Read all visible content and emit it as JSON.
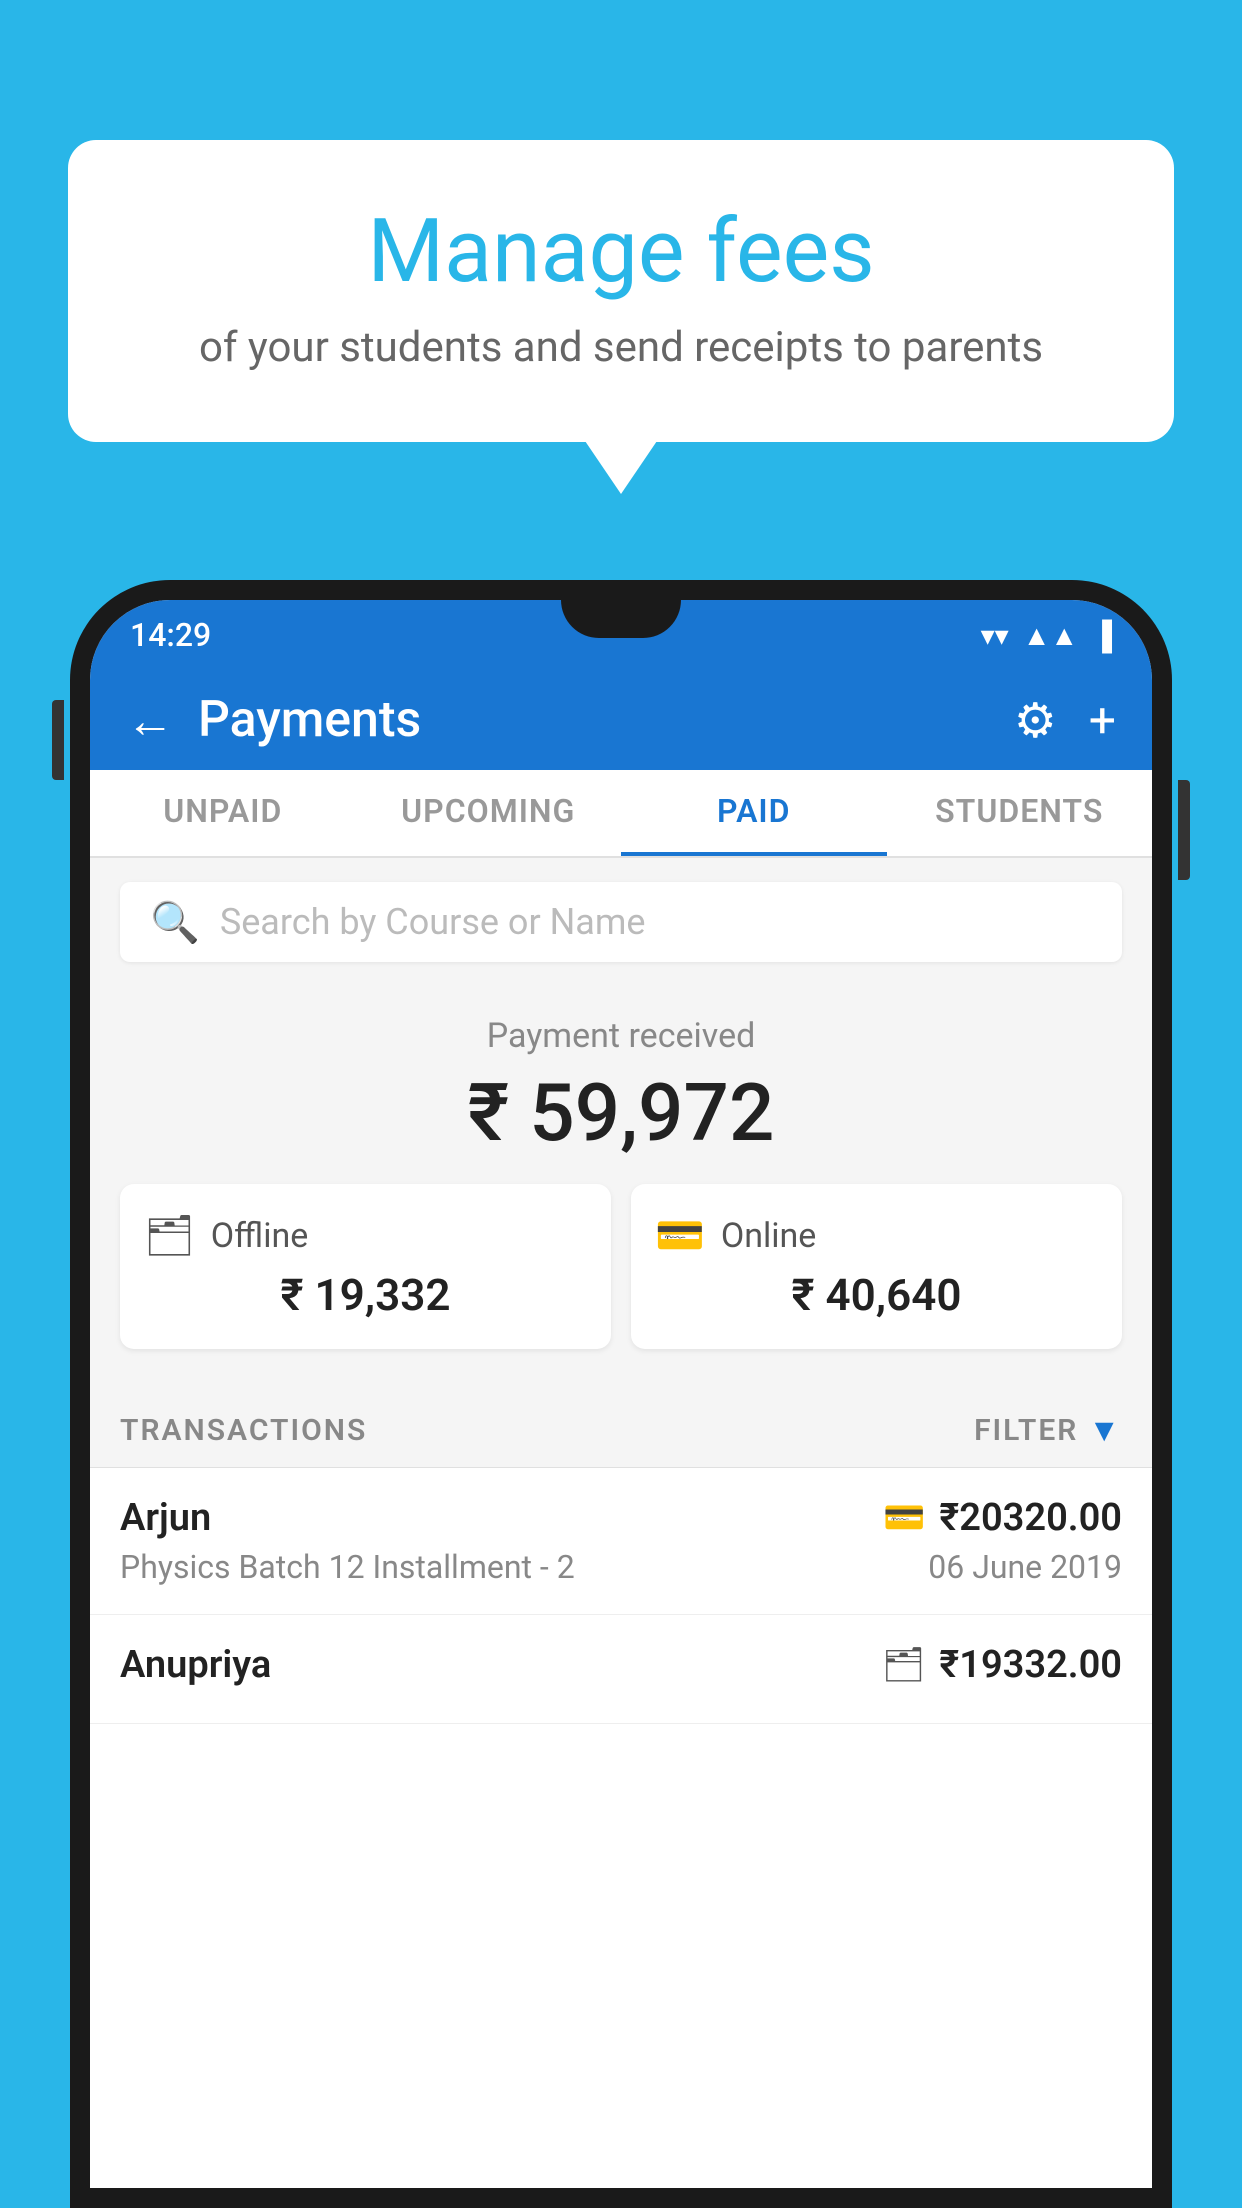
{
  "background_color": "#29b6e8",
  "speech_bubble": {
    "title": "Manage fees",
    "subtitle": "of your students and send receipts to parents"
  },
  "status_bar": {
    "time": "14:29",
    "wifi_icon": "wifi",
    "signal_icon": "signal",
    "battery_icon": "battery"
  },
  "top_bar": {
    "title": "Payments",
    "back_label": "←",
    "settings_label": "⚙",
    "add_label": "+"
  },
  "tabs": [
    {
      "label": "UNPAID",
      "active": false
    },
    {
      "label": "UPCOMING",
      "active": false
    },
    {
      "label": "PAID",
      "active": true
    },
    {
      "label": "STUDENTS",
      "active": false
    }
  ],
  "search": {
    "placeholder": "Search by Course or Name"
  },
  "payment_summary": {
    "label": "Payment received",
    "amount": "₹ 59,972",
    "offline": {
      "type": "Offline",
      "amount": "₹ 19,332"
    },
    "online": {
      "type": "Online",
      "amount": "₹ 40,640"
    }
  },
  "transactions_section": {
    "label": "TRANSACTIONS",
    "filter_label": "FILTER"
  },
  "transactions": [
    {
      "name": "Arjun",
      "course": "Physics Batch 12 Installment - 2",
      "amount": "₹20320.00",
      "date": "06 June 2019",
      "payment_type": "online"
    },
    {
      "name": "Anupriya",
      "course": "",
      "amount": "₹19332.00",
      "date": "",
      "payment_type": "offline"
    }
  ]
}
